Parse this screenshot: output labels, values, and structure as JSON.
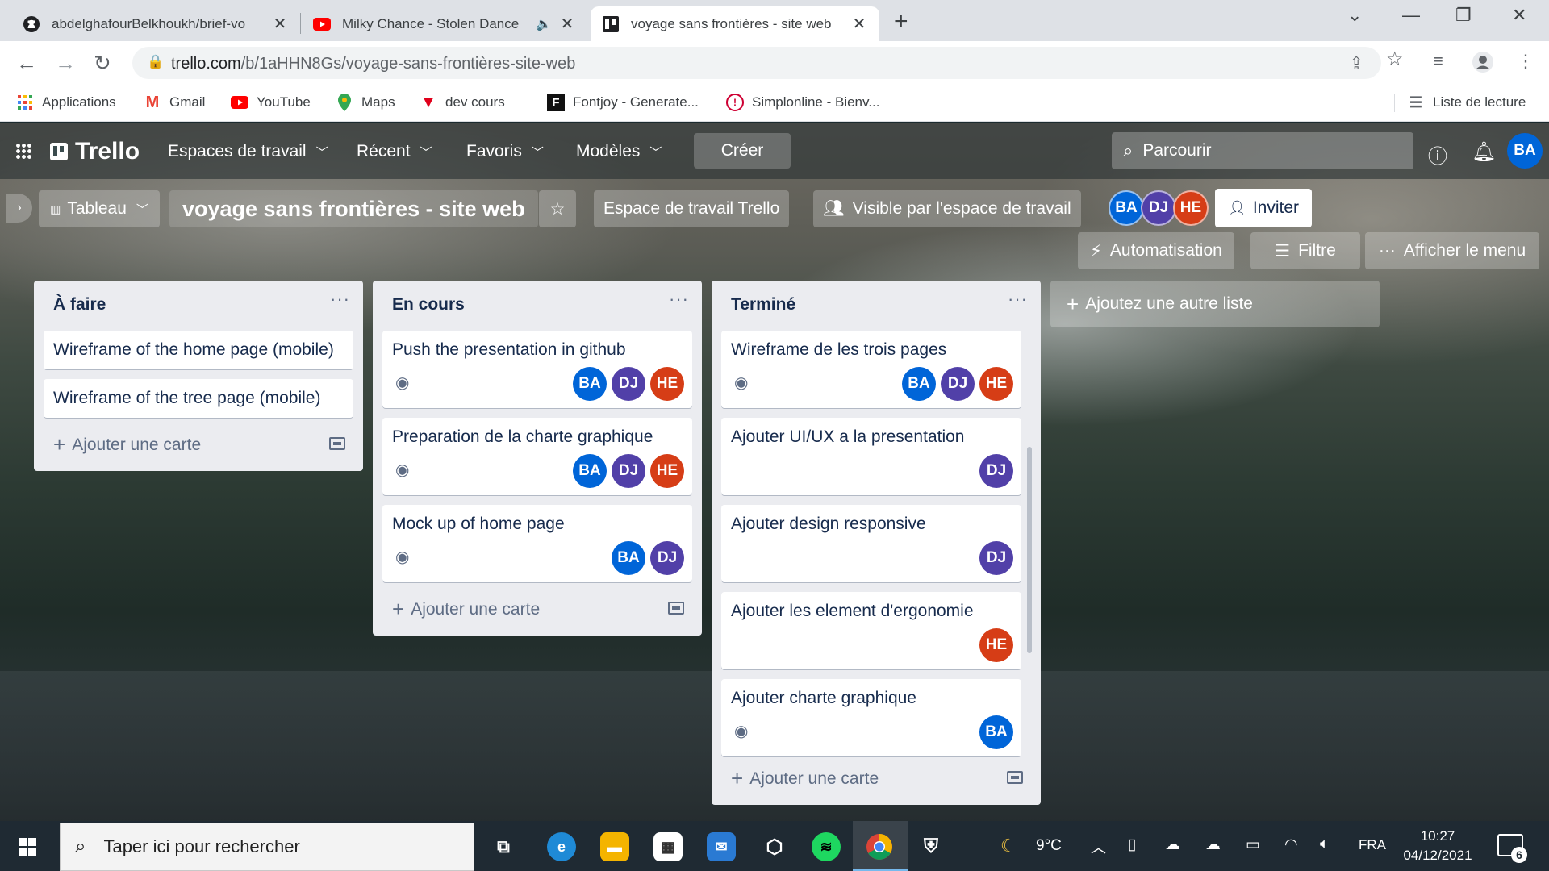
{
  "browser": {
    "tabs": [
      {
        "title": "abdelghafourBelkhoukh/brief-vo",
        "icon": "github-icon"
      },
      {
        "title": "Milky Chance - Stolen Dance",
        "icon": "youtube-icon",
        "audio": "speaker-icon"
      },
      {
        "title": "voyage sans frontières - site web",
        "icon": "trello-icon",
        "active": true
      }
    ],
    "url_host": "trello.com",
    "url_path": "/b/1aHHN8Gs/voyage-sans-frontières-site-web",
    "bookmarks": [
      {
        "label": "Applications",
        "icon": "apps-grid-icon"
      },
      {
        "label": "Gmail",
        "icon": "gmail-icon"
      },
      {
        "label": "YouTube",
        "icon": "youtube-icon"
      },
      {
        "label": "Maps",
        "icon": "maps-pin-icon"
      },
      {
        "label": "dev cours",
        "icon": "v-logo-icon"
      },
      {
        "label": "Fontjoy - Generate...",
        "icon": "fontjoy-icon"
      },
      {
        "label": "Simplonline - Bienv...",
        "icon": "simplon-icon"
      }
    ],
    "reading_list": "Liste de lecture"
  },
  "trello": {
    "brand": "Trello",
    "nav": {
      "workspaces": "Espaces de travail",
      "recent": "Récent",
      "starred": "Favoris",
      "templates": "Modèles",
      "create": "Créer",
      "search_placeholder": "Parcourir",
      "user_initials": "BA"
    },
    "board": {
      "view": "Tableau",
      "title": "voyage sans frontières - site web",
      "workspace": "Espace de travail Trello",
      "visibility": "Visible par l'espace de travail",
      "members": [
        "BA",
        "DJ",
        "HE"
      ],
      "invite": "Inviter",
      "automation": "Automatisation",
      "filter": "Filtre",
      "show_menu": "Afficher le menu",
      "add_list": "Ajoutez une autre liste"
    },
    "lists": [
      {
        "title": "À faire",
        "add_card": "Ajouter une carte",
        "cards": [
          {
            "title": "Wireframe of the home page (mobile)"
          },
          {
            "title": "Wireframe of the tree page (mobile)"
          }
        ]
      },
      {
        "title": "En cours",
        "add_card": "Ajouter une carte",
        "cards": [
          {
            "title": "Push the presentation in github",
            "watch": true,
            "members": [
              "BA",
              "DJ",
              "HE"
            ]
          },
          {
            "title": "Preparation de la charte graphique",
            "watch": true,
            "members": [
              "BA",
              "DJ",
              "HE"
            ]
          },
          {
            "title": "Mock up of home page",
            "watch": true,
            "members": [
              "BA",
              "DJ"
            ]
          }
        ]
      },
      {
        "title": "Terminé",
        "add_card": "Ajouter une carte",
        "cards": [
          {
            "title": "Wireframe de les trois pages",
            "watch": true,
            "members": [
              "BA",
              "DJ",
              "HE"
            ]
          },
          {
            "title": "Ajouter UI/UX a la presentation",
            "members": [
              "DJ"
            ]
          },
          {
            "title": "Ajouter design responsive",
            "members": [
              "DJ"
            ]
          },
          {
            "title": "Ajouter les element d'ergonomie",
            "members": [
              "HE"
            ]
          },
          {
            "title": "Ajouter charte graphique",
            "watch": true,
            "members": [
              "BA"
            ]
          }
        ]
      }
    ],
    "colors": {
      "BA": "#0065d8",
      "DJ": "#5140a8",
      "HE": "#d63d16"
    }
  },
  "taskbar": {
    "search_placeholder": "Taper ici pour rechercher",
    "weather": "9°C",
    "language": "FRA",
    "time": "10:27",
    "date": "04/12/2021",
    "notifications": "6"
  }
}
